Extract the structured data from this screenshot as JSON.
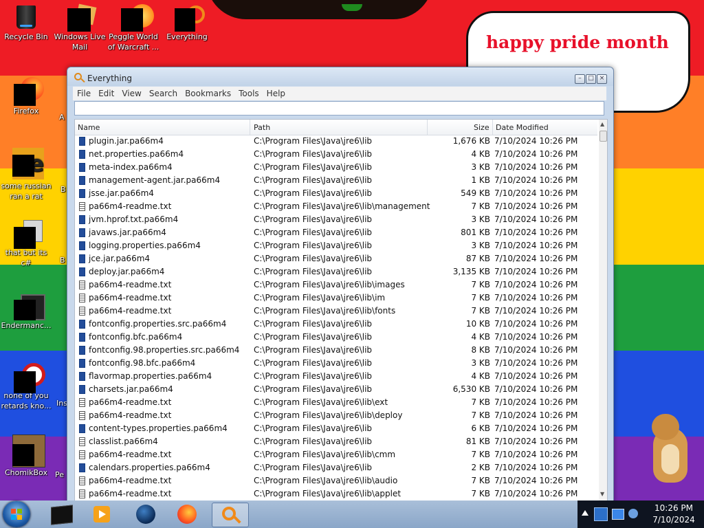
{
  "desktop": {
    "wallpaper_text": "happy pride month",
    "stripe_colors": [
      "#ee1c25",
      "#ff7f27",
      "#ffd200",
      "#1e9e3e",
      "#1f4fe0",
      "#7a2bb5"
    ],
    "icons": [
      {
        "label": "Recycle Bin"
      },
      {
        "label": "Windows Live Mail"
      },
      {
        "label": "Peggle World of Warcraft ..."
      },
      {
        "label": "Everything"
      },
      {
        "label": "Firefox"
      },
      {
        "label": "some russian ran a rat"
      },
      {
        "label": "that but its c#"
      },
      {
        "label": "Endermanc..."
      },
      {
        "label": "none of you retards kno..."
      },
      {
        "label": "ChomikBox"
      }
    ],
    "partial_labels": [
      "A",
      "B",
      "B",
      "Ins",
      "Pe"
    ]
  },
  "window": {
    "title": "Everything",
    "menu": [
      "File",
      "Edit",
      "View",
      "Search",
      "Bookmarks",
      "Tools",
      "Help"
    ],
    "search_value": "",
    "columns": {
      "name": "Name",
      "path": "Path",
      "size": "Size",
      "date": "Date Modified"
    },
    "rows": [
      {
        "name": "plugin.jar.pa66m4",
        "path": "C:\\Program Files\\Java\\jre6\\lib",
        "size": "1,676 KB",
        "date": "7/10/2024 10:26 PM",
        "icon": "jar"
      },
      {
        "name": "net.properties.pa66m4",
        "path": "C:\\Program Files\\Java\\jre6\\lib",
        "size": "4 KB",
        "date": "7/10/2024 10:26 PM",
        "icon": "jar"
      },
      {
        "name": "meta-index.pa66m4",
        "path": "C:\\Program Files\\Java\\jre6\\lib",
        "size": "3 KB",
        "date": "7/10/2024 10:26 PM",
        "icon": "jar"
      },
      {
        "name": "management-agent.jar.pa66m4",
        "path": "C:\\Program Files\\Java\\jre6\\lib",
        "size": "1 KB",
        "date": "7/10/2024 10:26 PM",
        "icon": "jar"
      },
      {
        "name": "jsse.jar.pa66m4",
        "path": "C:\\Program Files\\Java\\jre6\\lib",
        "size": "549 KB",
        "date": "7/10/2024 10:26 PM",
        "icon": "jar"
      },
      {
        "name": "pa66m4-readme.txt",
        "path": "C:\\Program Files\\Java\\jre6\\lib\\management",
        "size": "7 KB",
        "date": "7/10/2024 10:26 PM",
        "icon": "txt"
      },
      {
        "name": "jvm.hprof.txt.pa66m4",
        "path": "C:\\Program Files\\Java\\jre6\\lib",
        "size": "3 KB",
        "date": "7/10/2024 10:26 PM",
        "icon": "jar"
      },
      {
        "name": "javaws.jar.pa66m4",
        "path": "C:\\Program Files\\Java\\jre6\\lib",
        "size": "801 KB",
        "date": "7/10/2024 10:26 PM",
        "icon": "jar"
      },
      {
        "name": "logging.properties.pa66m4",
        "path": "C:\\Program Files\\Java\\jre6\\lib",
        "size": "3 KB",
        "date": "7/10/2024 10:26 PM",
        "icon": "jar"
      },
      {
        "name": "jce.jar.pa66m4",
        "path": "C:\\Program Files\\Java\\jre6\\lib",
        "size": "87 KB",
        "date": "7/10/2024 10:26 PM",
        "icon": "jar"
      },
      {
        "name": "deploy.jar.pa66m4",
        "path": "C:\\Program Files\\Java\\jre6\\lib",
        "size": "3,135 KB",
        "date": "7/10/2024 10:26 PM",
        "icon": "jar"
      },
      {
        "name": "pa66m4-readme.txt",
        "path": "C:\\Program Files\\Java\\jre6\\lib\\images",
        "size": "7 KB",
        "date": "7/10/2024 10:26 PM",
        "icon": "txt"
      },
      {
        "name": "pa66m4-readme.txt",
        "path": "C:\\Program Files\\Java\\jre6\\lib\\im",
        "size": "7 KB",
        "date": "7/10/2024 10:26 PM",
        "icon": "txt"
      },
      {
        "name": "pa66m4-readme.txt",
        "path": "C:\\Program Files\\Java\\jre6\\lib\\fonts",
        "size": "7 KB",
        "date": "7/10/2024 10:26 PM",
        "icon": "txt"
      },
      {
        "name": "fontconfig.properties.src.pa66m4",
        "path": "C:\\Program Files\\Java\\jre6\\lib",
        "size": "10 KB",
        "date": "7/10/2024 10:26 PM",
        "icon": "jar"
      },
      {
        "name": "fontconfig.bfc.pa66m4",
        "path": "C:\\Program Files\\Java\\jre6\\lib",
        "size": "4 KB",
        "date": "7/10/2024 10:26 PM",
        "icon": "jar"
      },
      {
        "name": "fontconfig.98.properties.src.pa66m4",
        "path": "C:\\Program Files\\Java\\jre6\\lib",
        "size": "8 KB",
        "date": "7/10/2024 10:26 PM",
        "icon": "jar"
      },
      {
        "name": "fontconfig.98.bfc.pa66m4",
        "path": "C:\\Program Files\\Java\\jre6\\lib",
        "size": "3 KB",
        "date": "7/10/2024 10:26 PM",
        "icon": "jar"
      },
      {
        "name": "flavormap.properties.pa66m4",
        "path": "C:\\Program Files\\Java\\jre6\\lib",
        "size": "4 KB",
        "date": "7/10/2024 10:26 PM",
        "icon": "jar"
      },
      {
        "name": "charsets.jar.pa66m4",
        "path": "C:\\Program Files\\Java\\jre6\\lib",
        "size": "6,530 KB",
        "date": "7/10/2024 10:26 PM",
        "icon": "jar"
      },
      {
        "name": "pa66m4-readme.txt",
        "path": "C:\\Program Files\\Java\\jre6\\lib\\ext",
        "size": "7 KB",
        "date": "7/10/2024 10:26 PM",
        "icon": "txt"
      },
      {
        "name": "pa66m4-readme.txt",
        "path": "C:\\Program Files\\Java\\jre6\\lib\\deploy",
        "size": "7 KB",
        "date": "7/10/2024 10:26 PM",
        "icon": "txt"
      },
      {
        "name": "content-types.properties.pa66m4",
        "path": "C:\\Program Files\\Java\\jre6\\lib",
        "size": "6 KB",
        "date": "7/10/2024 10:26 PM",
        "icon": "jar"
      },
      {
        "name": "classlist.pa66m4",
        "path": "C:\\Program Files\\Java\\jre6\\lib",
        "size": "81 KB",
        "date": "7/10/2024 10:26 PM",
        "icon": "txt"
      },
      {
        "name": "pa66m4-readme.txt",
        "path": "C:\\Program Files\\Java\\jre6\\lib\\cmm",
        "size": "7 KB",
        "date": "7/10/2024 10:26 PM",
        "icon": "txt"
      },
      {
        "name": "calendars.properties.pa66m4",
        "path": "C:\\Program Files\\Java\\jre6\\lib",
        "size": "2 KB",
        "date": "7/10/2024 10:26 PM",
        "icon": "jar"
      },
      {
        "name": "pa66m4-readme.txt",
        "path": "C:\\Program Files\\Java\\jre6\\lib\\audio",
        "size": "7 KB",
        "date": "7/10/2024 10:26 PM",
        "icon": "txt"
      },
      {
        "name": "pa66m4-readme.txt",
        "path": "C:\\Program Files\\Java\\jre6\\lib\\applet",
        "size": "7 KB",
        "date": "7/10/2024 10:26 PM",
        "icon": "txt"
      }
    ]
  },
  "taskbar": {
    "apps": [
      "console-app",
      "media-player",
      "globe-app",
      "firefox",
      "everything"
    ],
    "active_app": "everything",
    "clock_time": "10:26 PM",
    "clock_date": "7/10/2024"
  }
}
